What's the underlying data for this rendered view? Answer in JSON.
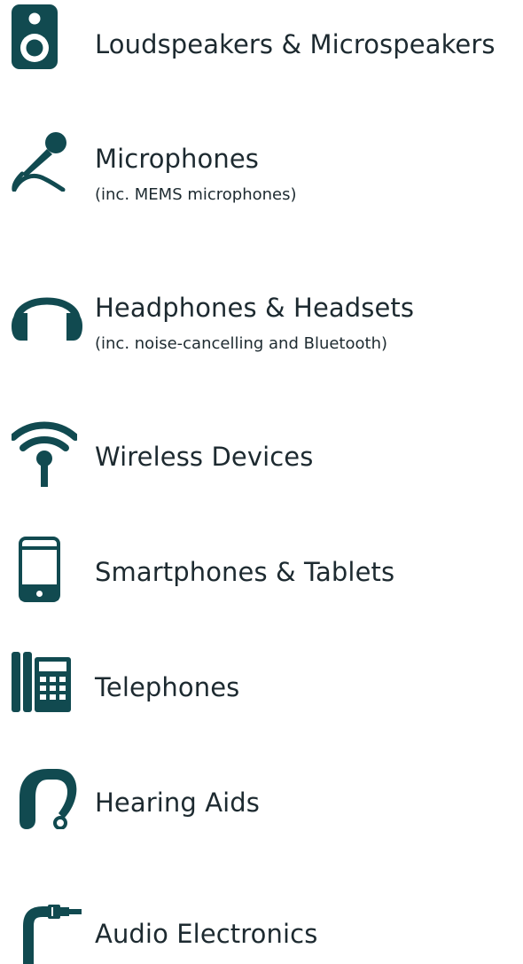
{
  "colors": {
    "icon": "#114a50",
    "text": "#1d2a30"
  },
  "categories": [
    {
      "icon": "speaker-icon",
      "label": "Loudspeakers & Microspeakers",
      "sub": ""
    },
    {
      "icon": "microphone-icon",
      "label": "Microphones",
      "sub": "(inc. MEMS microphones)"
    },
    {
      "icon": "headphones-icon",
      "label": "Headphones & Headsets",
      "sub": "(inc. noise-cancelling and Bluetooth)"
    },
    {
      "icon": "wireless-icon",
      "label": "Wireless Devices",
      "sub": ""
    },
    {
      "icon": "smartphone-icon",
      "label": "Smartphones & Tablets",
      "sub": ""
    },
    {
      "icon": "telephone-icon",
      "label": "Telephones",
      "sub": ""
    },
    {
      "icon": "hearing-aid-icon",
      "label": "Hearing Aids",
      "sub": ""
    },
    {
      "icon": "audio-cable-icon",
      "label": "Audio Electronics",
      "sub": ""
    }
  ]
}
